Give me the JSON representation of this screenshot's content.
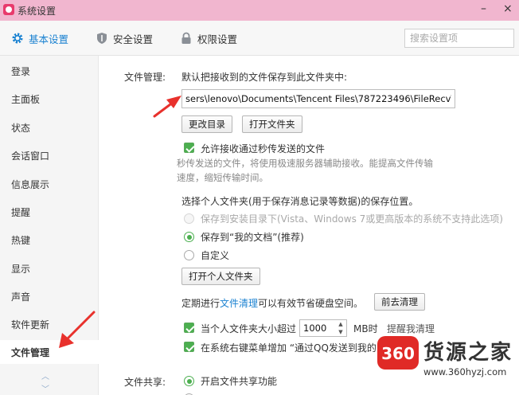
{
  "window": {
    "title": "系统设置",
    "minimize_glyph": "–",
    "close_glyph": "×"
  },
  "tabs": [
    {
      "label": "基本设置",
      "icon": "gear-icon",
      "active": true
    },
    {
      "label": "安全设置",
      "icon": "shield-icon",
      "active": false
    },
    {
      "label": "权限设置",
      "icon": "lock-icon",
      "active": false
    }
  ],
  "search": {
    "placeholder": "搜索设置项",
    "value": ""
  },
  "sidebar": {
    "items": [
      {
        "label": "登录"
      },
      {
        "label": "主面板"
      },
      {
        "label": "状态"
      },
      {
        "label": "会话窗口"
      },
      {
        "label": "信息展示"
      },
      {
        "label": "提醒"
      },
      {
        "label": "热键"
      },
      {
        "label": "显示"
      },
      {
        "label": "声音"
      },
      {
        "label": "软件更新"
      },
      {
        "label": "文件管理",
        "active": true
      }
    ],
    "scroll_up": "︿",
    "scroll_down": "﹀"
  },
  "file_management": {
    "section_label": "文件管理:",
    "save_prompt": "默认把接收到的文件保存到此文件夹中:",
    "path_value": "sers\\lenovo\\Documents\\Tencent Files\\787223496\\FileRecv\\",
    "change_dir_label": "更改目录",
    "open_folder_label": "打开文件夹",
    "allow_instant_label": "允许接收通过秒传发送的文件",
    "allow_instant_desc": "秒传发送的文件，将使用极速服务器辅助接收。能提高文件传输速度，缩短传输时间。",
    "personal_folder_prompt": "选择个人文件夹(用于保存消息记录等数据)的保存位置。",
    "radio_install_dir": "保存到安装目录下(Vista、Windows 7或更高版本的系统不支持此选项)",
    "radio_my_docs": "保存到“我的文档”(推荐)",
    "radio_custom": "自定义",
    "open_personal_label": "打开个人文件夹",
    "cleanup_prefix": "定期进行",
    "cleanup_link": "文件清理",
    "cleanup_suffix": "可以有效节省硬盘空间。",
    "cleanup_button": "前去清理",
    "size_limit_label": "当个人文件夹大小超过",
    "size_limit_value": "1000",
    "size_limit_unit": "MB时",
    "size_limit_tail": "提醒我清理",
    "context_menu_label": "在系统右键菜单增加 “通过QQ发送到我的"
  },
  "file_sharing": {
    "section_label": "文件共享:",
    "enable_label": "开启文件共享功能"
  },
  "watermark": {
    "badge_text": "360",
    "name": "货源之家",
    "url": "www.360hyzj.com"
  },
  "colors": {
    "accent": "#1b82d1",
    "title_bar": "#f1b6cf",
    "check_green": "#4caf50",
    "arrow_red": "#e8312c",
    "watermark_red": "#e02a26"
  }
}
